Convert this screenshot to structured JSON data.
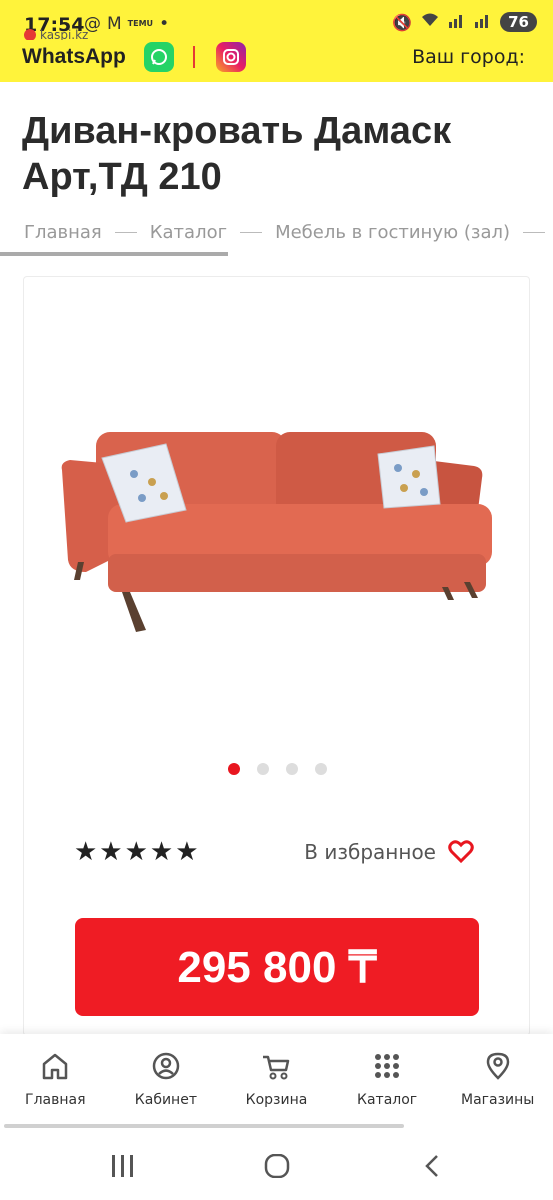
{
  "status_bar": {
    "time": "17:54",
    "temu": "TEMU",
    "battery": "76",
    "url": "kaspi.kz"
  },
  "header": {
    "whatsapp_label": "WhatsApp",
    "city_label": "Ваш город:"
  },
  "product": {
    "title": "Диван-кровать Дамаск Арт,ТД 210",
    "rating_stars": "★★★★★",
    "favorite_label": "В избранное",
    "price": "295 800 ₸",
    "image_count": 4,
    "active_image": 1
  },
  "breadcrumb": [
    "Главная",
    "Каталог",
    "Мебель в гостиную (зал)"
  ],
  "bottom_nav": [
    {
      "label": "Главная",
      "icon": "home-icon"
    },
    {
      "label": "Кабинет",
      "icon": "account-icon"
    },
    {
      "label": "Корзина",
      "icon": "cart-icon"
    },
    {
      "label": "Каталог",
      "icon": "grid-icon"
    },
    {
      "label": "Магазины",
      "icon": "location-icon"
    }
  ],
  "colors": {
    "accent_yellow": "#fff33b",
    "price_red": "#ef1c24",
    "favorite_heart": "#e8161f",
    "sofa": "#d9634d"
  }
}
